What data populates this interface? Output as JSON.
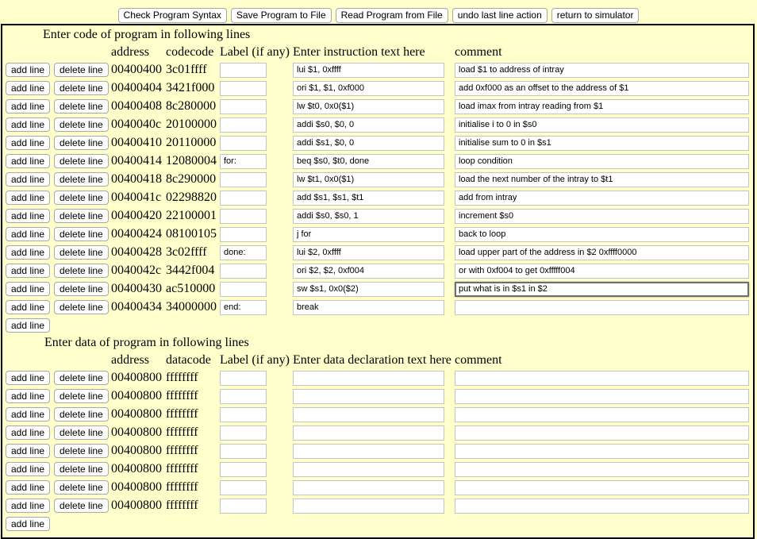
{
  "toolbar": {
    "check_syntax": "Check Program Syntax",
    "save": "Save Program to File",
    "read": "Read Program from File",
    "undo": "undo last line action",
    "return": "return to simulator"
  },
  "code_section": {
    "heading": "Enter code of program in following lines",
    "headers": {
      "address": "address",
      "codecode": "codecode",
      "label": "Label (if any)",
      "instruction": "Enter instruction text here",
      "comment": "comment"
    },
    "add_line_label": "add line",
    "delete_line_label": "delete line",
    "rows": [
      {
        "address": "00400400",
        "code": "3c01ffff",
        "label": "",
        "instruction": "lui $1, 0xffff",
        "comment": "load $1 to address of intray"
      },
      {
        "address": "00400404",
        "code": "3421f000",
        "label": "",
        "instruction": "ori $1, $1, 0xf000",
        "comment": "add 0xf000 as an offset to the address of $1"
      },
      {
        "address": "00400408",
        "code": "8c280000",
        "label": "",
        "instruction": "lw $t0, 0x0($1)",
        "comment": "load imax from intray reading from $1"
      },
      {
        "address": "0040040c",
        "code": "20100000",
        "label": "",
        "instruction": "addi $s0, $0, 0",
        "comment": "initialise i to 0 in $s0"
      },
      {
        "address": "00400410",
        "code": "20110000",
        "label": "",
        "instruction": "addi $s1, $0, 0",
        "comment": "initialise sum to 0 in $s1"
      },
      {
        "address": "00400414",
        "code": "12080004",
        "label": "for:",
        "instruction": "beq $s0, $t0, done",
        "comment": "loop condition"
      },
      {
        "address": "00400418",
        "code": "8c290000",
        "label": "",
        "instruction": "lw $t1, 0x0($1)",
        "comment": "load the next number of the intray to $t1"
      },
      {
        "address": "0040041c",
        "code": "02298820",
        "label": "",
        "instruction": "add $s1, $s1, $t1",
        "comment": "add from intray"
      },
      {
        "address": "00400420",
        "code": "22100001",
        "label": "",
        "instruction": "addi $s0, $s0, 1",
        "comment": "increment $s0"
      },
      {
        "address": "00400424",
        "code": "08100105",
        "label": "",
        "instruction": "j for",
        "comment": "back to loop"
      },
      {
        "address": "00400428",
        "code": "3c02ffff",
        "label": "done:",
        "instruction": "lui $2, 0xffff",
        "comment": "load upper part of the address in $2 0xffff0000"
      },
      {
        "address": "0040042c",
        "code": "3442f004",
        "label": "",
        "instruction": "ori $2, $2, 0xf004",
        "comment": "or with 0xf004 to get 0xfffff004"
      },
      {
        "address": "00400430",
        "code": "ac510000",
        "label": "",
        "instruction": "sw $s1, 0x0($2)",
        "comment": "put what is in $s1 in $2"
      },
      {
        "address": "00400434",
        "code": "34000000",
        "label": "end:",
        "instruction": "break",
        "comment": ""
      }
    ]
  },
  "data_section": {
    "heading": "Enter data of program in following lines",
    "headers": {
      "address": "address",
      "datacode": "datacode",
      "label": "Label (if any)",
      "declaration": "Enter data declaration text here",
      "comment": "comment"
    },
    "rows": [
      {
        "address": "00400800",
        "code": "ffffffff",
        "label": "",
        "declaration": "",
        "comment": ""
      },
      {
        "address": "00400800",
        "code": "ffffffff",
        "label": "",
        "declaration": "",
        "comment": ""
      },
      {
        "address": "00400800",
        "code": "ffffffff",
        "label": "",
        "declaration": "",
        "comment": ""
      },
      {
        "address": "00400800",
        "code": "ffffffff",
        "label": "",
        "declaration": "",
        "comment": ""
      },
      {
        "address": "00400800",
        "code": "ffffffff",
        "label": "",
        "declaration": "",
        "comment": ""
      },
      {
        "address": "00400800",
        "code": "ffffffff",
        "label": "",
        "declaration": "",
        "comment": ""
      },
      {
        "address": "00400800",
        "code": "ffffffff",
        "label": "",
        "declaration": "",
        "comment": ""
      },
      {
        "address": "00400800",
        "code": "ffffffff",
        "label": "",
        "declaration": "",
        "comment": ""
      }
    ]
  },
  "focused_comment_row": 12
}
